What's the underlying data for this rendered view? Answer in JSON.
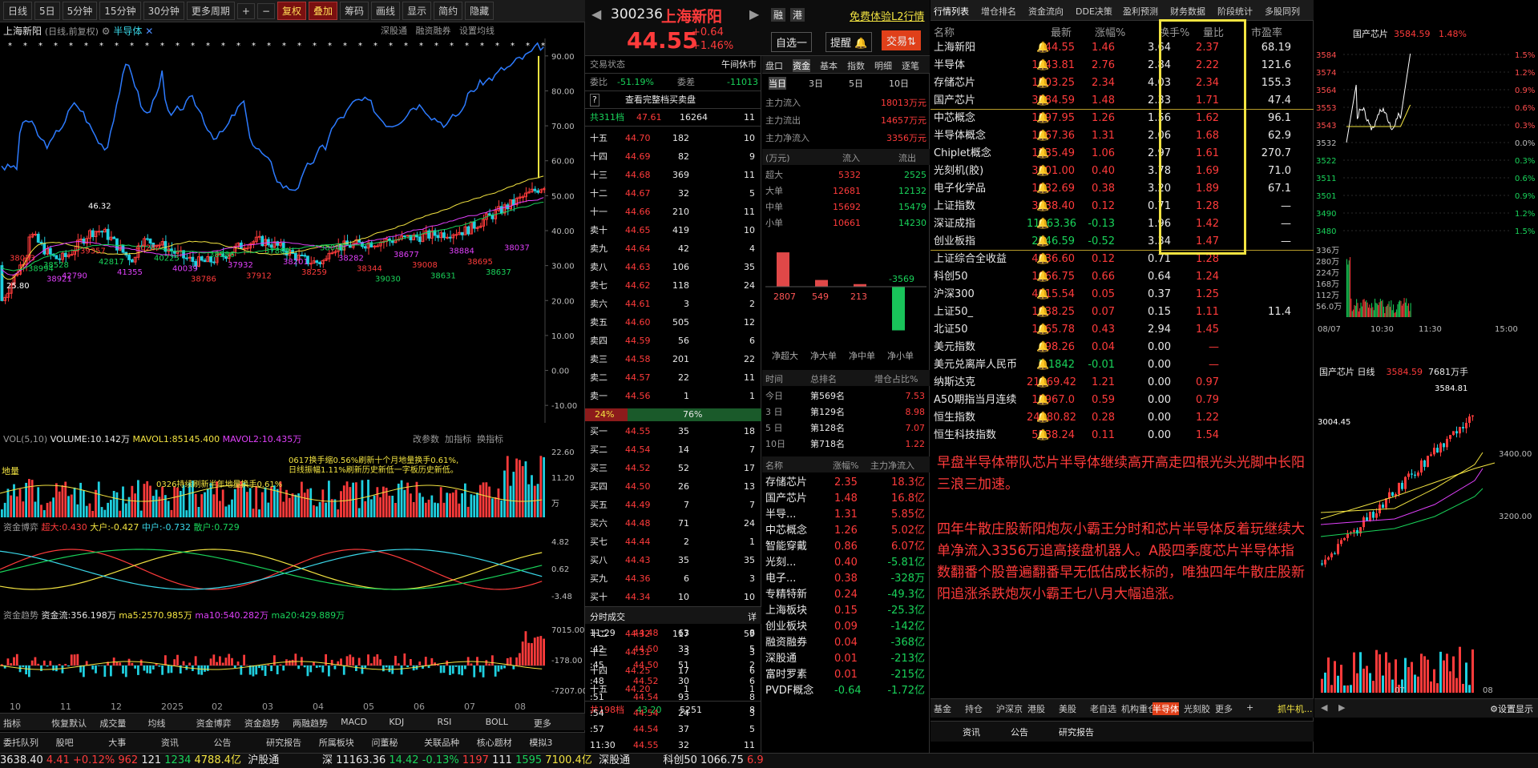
{
  "toolbar": {
    "items": [
      "日线",
      "5日",
      "5分钟",
      "15分钟",
      "30分钟",
      "更多周期",
      "+",
      "−",
      "复权",
      "叠加",
      "筹码",
      "画线",
      "显示",
      "简约",
      "隐藏"
    ]
  },
  "chart": {
    "title": "上海新阳",
    "sub": "(日线,前复权)",
    "sector": "半导体",
    "links": [
      "深股通",
      "融资融券",
      "设置均线"
    ],
    "price_labels": [
      "90.00",
      "80.00",
      "70.00",
      "60.00",
      "50.00",
      "40.00",
      "30.00",
      "20.00",
      "10.00",
      "0.00",
      "-10.00"
    ],
    "markers": [
      "46.32",
      "25.80",
      "38528",
      "42790",
      "39357",
      "42817",
      "41355",
      "40287",
      "40225",
      "40039",
      "38786",
      "38586",
      "37932",
      "37912",
      "37869",
      "38201",
      "38259",
      "38046",
      "38282",
      "38344",
      "39030",
      "38677",
      "39008",
      "38631",
      "38884",
      "38695",
      "38637",
      "38037",
      "38033",
      "38994",
      "38921"
    ],
    "x_labels": [
      "10",
      "11",
      "12",
      "2025",
      "02",
      "03",
      "04",
      "05",
      "06",
      "07",
      "08"
    ]
  },
  "vol": {
    "title": "VOL(5,10)",
    "volume": "VOLUME:10.142万",
    "m1": "MAVOL1:85145.400",
    "m2": "MAVOL2:10.435万",
    "btns": [
      "改参数",
      "加指标",
      "换指标"
    ],
    "ann1": "0617换手缩0.56%刷新十个月地量换手0.61%,",
    "ann2": "日线振幅1.11%刷新历史新低一字板历史新低。",
    "ann3": "0326持续刷新半年地量换手0.61%",
    "ann4": "地量",
    "ticks": [
      "22.60",
      "11.20",
      "万"
    ]
  },
  "fund": {
    "title": "资金博弈",
    "a": "超大:0.430",
    "b": "大户:-0.427",
    "c": "中户:-0.732",
    "d": "散户:0.729",
    "ticks": [
      "4.82",
      "0.62",
      "-3.48"
    ]
  },
  "trend": {
    "title": "资金趋势",
    "a": "资金流:356.198万",
    "b": "ma5:2570.985万",
    "c": "ma10:540.282万",
    "d": "ma20:429.889万",
    "ticks": [
      "7015.00",
      "-178.00",
      "-7207.00"
    ]
  },
  "lower_tabs": [
    "指标",
    "恢复默认",
    "成交量",
    "均线",
    "资金博弈",
    "资金趋势",
    "两融趋势",
    "MACD",
    "KDJ",
    "RSI",
    "BOLL",
    "更多"
  ],
  "lower_tabs2": [
    "委托队列",
    "股吧",
    "大事",
    "资讯",
    "公告",
    "研究报告",
    "所属板块",
    "问董秘",
    "关联品种",
    "核心题材",
    "模拟3"
  ],
  "stock": {
    "code": "300236",
    "name": "上海新阳",
    "price": "44.55",
    "chg": "+0.64",
    "pct": "+1.46%",
    "badge1": "融",
    "badge2": "港",
    "free": "免费体验L2行情",
    "sel": "自选一",
    "alert": "提醒",
    "trade": "交易"
  },
  "status": {
    "label": "交易状态",
    "value": "午间休市",
    "ratio_l": "委比",
    "ratio": "-51.19%",
    "diff_l": "委差",
    "diff": "-11013",
    "full": "查看完整档买卖盘",
    "total_l": "共311档",
    "total_p": "47.61",
    "total_v": "16264",
    "total_n": "11"
  },
  "asks": [
    [
      "十五",
      "44.70",
      "182",
      "10"
    ],
    [
      "十四",
      "44.69",
      "82",
      "9"
    ],
    [
      "十三",
      "44.68",
      "369",
      "11"
    ],
    [
      "十二",
      "44.67",
      "32",
      "5"
    ],
    [
      "十一",
      "44.66",
      "210",
      "11"
    ],
    [
      "卖十",
      "44.65",
      "419",
      "10"
    ],
    [
      "卖九",
      "44.64",
      "42",
      "4"
    ],
    [
      "卖八",
      "44.63",
      "106",
      "35"
    ],
    [
      "卖七",
      "44.62",
      "118",
      "24"
    ],
    [
      "卖六",
      "44.61",
      "3",
      "2"
    ],
    [
      "卖五",
      "44.60",
      "505",
      "12"
    ],
    [
      "卖四",
      "44.59",
      "56",
      "6"
    ],
    [
      "卖三",
      "44.58",
      "201",
      "22"
    ],
    [
      "卖二",
      "44.57",
      "22",
      "11"
    ],
    [
      "卖一",
      "44.56",
      "1",
      "1"
    ]
  ],
  "bar24": {
    "l": "24%",
    "r": "76%"
  },
  "bids": [
    [
      "买一",
      "44.55",
      "35",
      "18"
    ],
    [
      "买二",
      "44.54",
      "14",
      "7"
    ],
    [
      "买三",
      "44.52",
      "52",
      "17"
    ],
    [
      "买四",
      "44.50",
      "26",
      "13"
    ],
    [
      "买五",
      "44.49",
      "7",
      "7"
    ],
    [
      "买六",
      "44.48",
      "71",
      "24"
    ],
    [
      "买七",
      "44.44",
      "2",
      "1"
    ],
    [
      "买八",
      "44.43",
      "35",
      "35"
    ],
    [
      "买九",
      "44.36",
      "6",
      "3"
    ],
    [
      "买十",
      "44.34",
      "10",
      "10"
    ],
    [
      "十一",
      "44.33",
      "47",
      "9"
    ],
    [
      "十二",
      "44.32",
      "117",
      "59"
    ],
    [
      "十三",
      "44.31",
      "3",
      "3"
    ],
    [
      "十四",
      "44.25",
      "17",
      "6"
    ],
    [
      "十五",
      "44.20",
      "1",
      "1"
    ]
  ],
  "bidtotal": {
    "l": "共198档",
    "p": "43.20",
    "v": "5251",
    "n": "8"
  },
  "trades_title": "分时成交",
  "trades_btn": "详",
  "trades": [
    [
      "11:29",
      "44.48",
      "63",
      "8"
    ],
    [
      ":42",
      "44.50",
      "33",
      "5"
    ],
    [
      ":45",
      "44.50",
      "51",
      "2"
    ],
    [
      ":48",
      "44.52",
      "30",
      "6"
    ],
    [
      ":51",
      "44.54",
      "93",
      "8"
    ],
    [
      ":54",
      "44.54",
      "24",
      "3"
    ],
    [
      ":57",
      "44.54",
      "37",
      "5"
    ],
    [
      "11:30",
      "44.55",
      "32",
      "11"
    ]
  ],
  "ftabs": [
    "盘口",
    "资金",
    "基本",
    "指数",
    "明细",
    "逐笔"
  ],
  "ftabs2": [
    "当日",
    "3日",
    "5日",
    "10日"
  ],
  "flow": [
    [
      "主力流入",
      "18013万元"
    ],
    [
      "主力流出",
      "14657万元"
    ],
    [
      "主力净流入",
      "3356万元"
    ]
  ],
  "flowhdr": [
    "(万元)",
    "流入",
    "流出"
  ],
  "flowtbl": [
    [
      "超大",
      "5332",
      "2525"
    ],
    [
      "大单",
      "12681",
      "12132"
    ],
    [
      "中单",
      "15692",
      "15479"
    ],
    [
      "小单",
      "10661",
      "14230"
    ]
  ],
  "netbars": {
    "vals": [
      "2807",
      "549",
      "213",
      "-3569"
    ],
    "labels": [
      "净超大",
      "净大单",
      "净中单",
      "净小单"
    ]
  },
  "rank": {
    "hdr": [
      "时间",
      "总排名",
      "增仓占比%"
    ],
    "rows": [
      [
        "今日",
        "第569名",
        "7.53"
      ],
      [
        "3 日",
        "第129名",
        "8.98"
      ],
      [
        "5 日",
        "第128名",
        "7.07"
      ],
      [
        "10日",
        "第718名",
        "1.22"
      ]
    ]
  },
  "sect": {
    "hdr": [
      "名称",
      "涨幅%",
      "主力净流入"
    ],
    "rows": [
      [
        "存储芯片",
        "2.35",
        "18.3亿"
      ],
      [
        "国产芯片",
        "1.48",
        "16.8亿"
      ],
      [
        "半导...",
        "1.31",
        "5.85亿"
      ],
      [
        "中芯概念",
        "1.26",
        "5.02亿"
      ],
      [
        "智能穿戴",
        "0.86",
        "6.07亿"
      ],
      [
        "光刻...",
        "0.40",
        "-5.81亿"
      ],
      [
        "电子...",
        "0.38",
        "-328万"
      ],
      [
        "专精特新",
        "0.24",
        "-49.3亿"
      ],
      [
        "上海板块",
        "0.15",
        "-25.3亿"
      ],
      [
        "创业板块",
        "0.09",
        "-142亿"
      ],
      [
        "融资融券",
        "0.04",
        "-368亿"
      ],
      [
        "深股通",
        "0.01",
        "-213亿"
      ],
      [
        "富时罗素",
        "0.01",
        "-215亿"
      ],
      [
        "PVDF概念",
        "-0.64",
        "-1.72亿"
      ]
    ]
  },
  "qtabs": [
    "行情列表",
    "增仓排名",
    "资金流向",
    "DDE决策",
    "盈利预测",
    "财务数据",
    "阶段统计",
    "多股同列"
  ],
  "qhdr": [
    "名称",
    "最新",
    "涨幅%",
    "换手%",
    "量比",
    "市盈率"
  ],
  "quotes": [
    [
      "上海新阳",
      "44.55",
      "1.46",
      "3.64",
      "2.37",
      "68.19"
    ],
    [
      "半导体",
      "1643.81",
      "2.76",
      "2.84",
      "2.22",
      "121.6"
    ],
    [
      "存储芯片",
      "1503.25",
      "2.34",
      "4.03",
      "2.34",
      "155.3"
    ],
    [
      "国产芯片",
      "3584.59",
      "1.48",
      "2.33",
      "1.71",
      "47.4"
    ],
    [
      "中芯概念",
      "1397.95",
      "1.26",
      "1.56",
      "1.62",
      "96.1"
    ],
    [
      "半导体概念",
      "1867.36",
      "1.31",
      "2.06",
      "1.68",
      "62.9"
    ],
    [
      "Chiplet概念",
      "1735.49",
      "1.06",
      "2.97",
      "1.61",
      "270.7"
    ],
    [
      "光刻机(胶)",
      "3201.00",
      "0.40",
      "3.78",
      "1.69",
      "71.0"
    ],
    [
      "电子化学品",
      "1832.69",
      "0.38",
      "3.20",
      "1.89",
      "67.1"
    ],
    [
      "上证指数",
      "3638.40",
      "0.12",
      "0.71",
      "1.28",
      "—"
    ],
    [
      "深证成指",
      "11163.36",
      "-0.13",
      "1.96",
      "1.42",
      "—"
    ],
    [
      "创业板指",
      "2346.59",
      "-0.52",
      "3.34",
      "1.47",
      "—"
    ],
    [
      "上证综合全收益",
      "4136.60",
      "0.12",
      "0.71",
      "1.28",
      ""
    ],
    [
      "科创50",
      "1066.75",
      "0.66",
      "0.64",
      "1.24",
      ""
    ],
    [
      "沪深300",
      "4115.54",
      "0.05",
      "0.37",
      "1.25",
      ""
    ],
    [
      "上证50_",
      "1938.25",
      "0.07",
      "0.15",
      "1.11",
      "11.4"
    ],
    [
      "北证50",
      "1465.78",
      "0.43",
      "2.94",
      "1.45",
      ""
    ],
    [
      "美元指数",
      "98.26",
      "0.04",
      "0.00",
      "—",
      ""
    ],
    [
      "美元兑离岸人民币",
      "7.1842",
      "-0.01",
      "0.00",
      "—",
      ""
    ],
    [
      "纳斯达克",
      "21169.42",
      "1.21",
      "0.00",
      "0.97",
      ""
    ],
    [
      "A50期指当月连续",
      "13967.0",
      "0.59",
      "0.00",
      "0.79",
      ""
    ],
    [
      "恒生指数",
      "24980.82",
      "0.28",
      "0.00",
      "1.22",
      ""
    ],
    [
      "恒生科技指数",
      "5538.24",
      "0.11",
      "0.00",
      "1.54",
      ""
    ]
  ],
  "note1": "早盘半导体带队芯片半导体继续高开高走四根光头光脚中长阳三浪三加速。",
  "note2": "四年牛散庄股新阳炮灰小霸王分时和芯片半导体反着玩继续大单净流入3356万追高接盘机器人。A股四季度芯片半导体指数翻番个股普遍翻番早无低估成长标的，唯独四年牛散庄股新阳追涨杀跌炮灰小霸王七八月大幅追涨。",
  "qbottom": [
    "基金",
    "持仓",
    "沪深京",
    "港股",
    "美股",
    "老自选",
    "机构重仓",
    "半导体",
    "光刻胶",
    "更多",
    "+",
    "抓牛机..."
  ],
  "qbottom2": [
    "资讯",
    "公告",
    "研究报告"
  ],
  "mini": {
    "name": "国产芯片",
    "price": "3584.59",
    "pct": "1.48%",
    "ticks_l": [
      "3584",
      "3574",
      "3564",
      "3553",
      "3543",
      "3532",
      "3522",
      "3511",
      "3501",
      "3490",
      "3480"
    ],
    "ticks_r": [
      "1.5%",
      "1.2%",
      "0.9%",
      "0.6%",
      "0.3%",
      "0.0%",
      "0.3%",
      "0.6%",
      "0.9%",
      "1.2%",
      "1.5%"
    ],
    "vticks": [
      "336万",
      "280万",
      "224万",
      "168万",
      "112万",
      "56.0万"
    ],
    "times": [
      "08/07",
      "10:30",
      "11:30",
      "15:00"
    ]
  },
  "daily": {
    "name": "国产芯片",
    "period": "日线",
    "price": "3584.59",
    "vol": "7681万手",
    "hi": "3584.81",
    "lo": "3004.45",
    "ticks": [
      "3400.00",
      "3200.00"
    ],
    "x": [
      "07",
      "08"
    ],
    "set": "设置显示"
  },
  "statusbar": {
    "a": "3638.40",
    "b": "4.41",
    "c": "+0.12%",
    "d": "962",
    "e": "121",
    "f": "1234",
    "g": "4788.4亿",
    "h": "沪股通",
    "i": "深",
    "j": "11163.36",
    "k": "14.42",
    "l": "-0.13%",
    "m": "1197",
    "n": "111",
    "o": "1595",
    "p": "7100.4亿",
    "q": "深股通",
    "r": "科创50",
    "s": "1066.75",
    "t": "6.9"
  },
  "settings": "设置显示"
}
